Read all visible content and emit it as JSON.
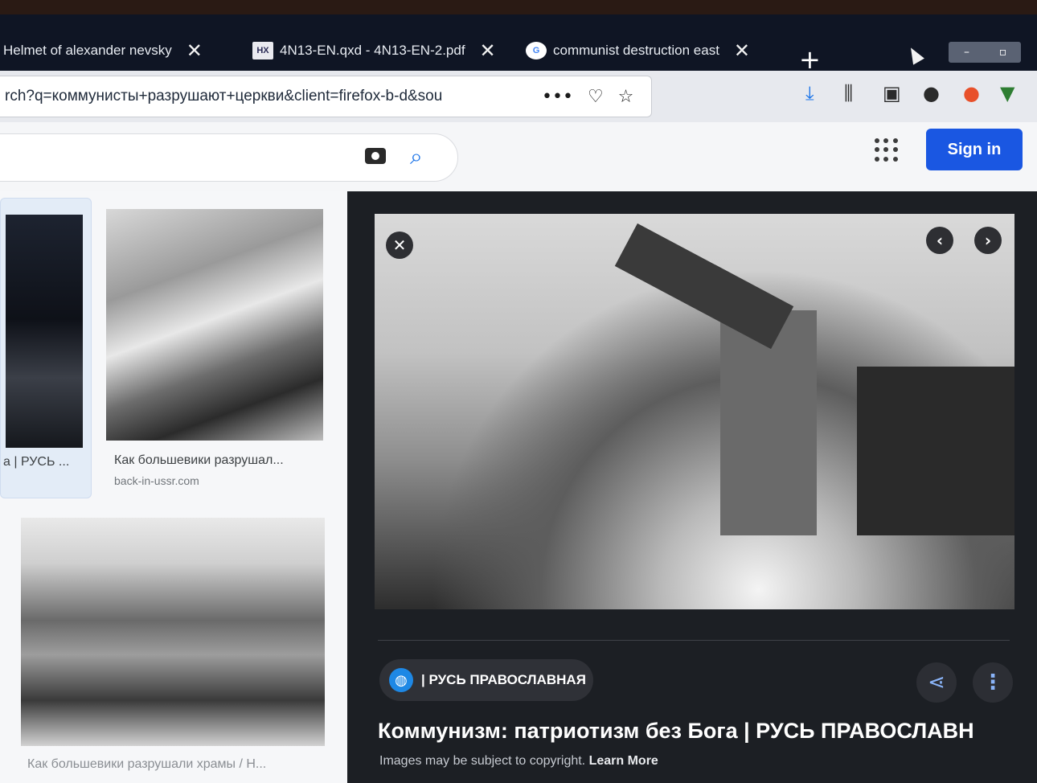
{
  "browser": {
    "tabs": [
      {
        "label": "Helmet of alexander nevsky",
        "favicon": "none"
      },
      {
        "label": "4N13-EN.qxd - 4N13-EN-2.pdf",
        "favicon": "HX"
      },
      {
        "label": "communist destruction east",
        "favicon": "G"
      }
    ],
    "url": "rch?q=коммунисты+разрушают+церкви&client=firefox-b-d&sou"
  },
  "google": {
    "signin_label": "Sign in"
  },
  "results": [
    {
      "caption": "а | РУСЬ ...",
      "source": ""
    },
    {
      "caption": "Как большевики разрушал...",
      "source": "back-in-ussr.com"
    },
    {
      "caption": "Как большевики разрушали храмы / Н...",
      "source": ""
    }
  ],
  "preview": {
    "source_label": "| РУСЬ ПРАВОСЛАВНАЯ",
    "title": "Коммунизм: патриотизм без Бога | РУСЬ ПРАВОСЛАВН",
    "note_prefix": "Images may be subject to copyright.",
    "note_link": "Learn More"
  },
  "colors": {
    "signin_button": "#1a57e2",
    "tab_strip": "#0f1524",
    "preview_bg": "#1c1f24"
  }
}
